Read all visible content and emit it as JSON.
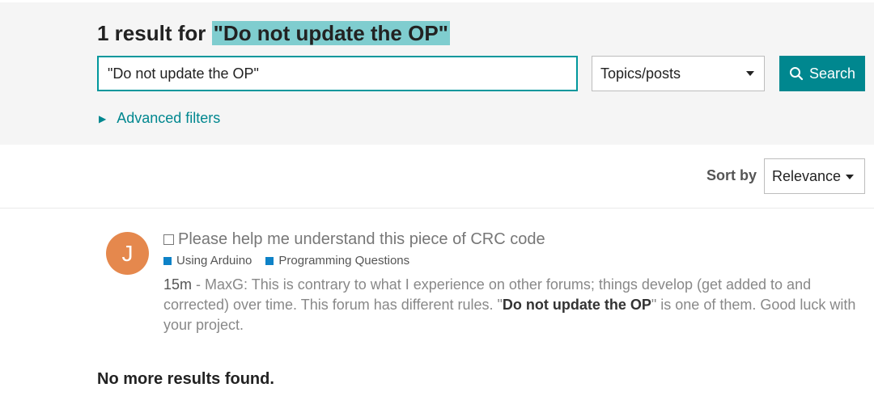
{
  "header": {
    "result_prefix": "1 result for ",
    "query_quoted": "\"Do not update the OP\""
  },
  "search": {
    "value": "\"Do not update the OP\"",
    "type_selected": "Topics/posts",
    "button_label": "Search",
    "advanced_filters_label": "Advanced filters"
  },
  "sort": {
    "label": "Sort by",
    "selected": "Relevance"
  },
  "results": [
    {
      "avatar_letter": "J",
      "avatar_color": "#e5884d",
      "title": "Please help me understand this piece of CRC code",
      "categories": [
        "Using Arduino",
        "Programming Questions"
      ],
      "category_color": "#0e82c7",
      "date": "15m",
      "blurb_before": " - MaxG: This is contrary to what I experience on other forums; things develop (get added to and corrected) over time. This forum has different rules. \"",
      "blurb_highlight": "Do not update the OP",
      "blurb_after": "\" is one of them. Good luck with your project."
    }
  ],
  "footer": {
    "no_more": "No more results found."
  },
  "colors": {
    "accent": "#00878f",
    "highlight": "#7fcdcf"
  },
  "icons": {
    "search": "search-icon",
    "dropdown": "caret-down-icon",
    "expand": "triangle-right-icon"
  }
}
